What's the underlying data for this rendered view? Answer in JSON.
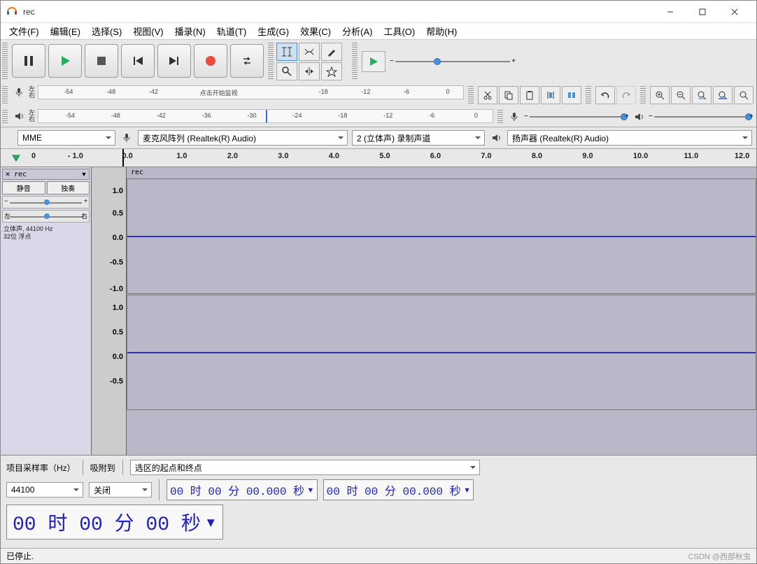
{
  "window": {
    "title": "rec"
  },
  "menu": [
    "文件(F)",
    "编辑(E)",
    "选择(S)",
    "视图(V)",
    "播录(N)",
    "轨道(T)",
    "生成(G)",
    "效果(C)",
    "分析(A)",
    "工具(O)",
    "帮助(H)"
  ],
  "rec_meter": {
    "ticks": [
      "-54",
      "-48",
      "-42",
      "",
      "",
      "-18",
      "-12",
      "-6",
      "0"
    ],
    "hint": "点击开始监视"
  },
  "play_meter": {
    "ticks": [
      "-54",
      "-48",
      "-42",
      "-36",
      "-30",
      "-24",
      "-18",
      "-12",
      "-6",
      "0"
    ]
  },
  "device": {
    "host_label": "MME",
    "rec_device": "麦克风阵列 (Realtek(R) Audio)",
    "channels": "2 (立体声) 录制声道",
    "play_device": "扬声器 (Realtek(R) Audio)"
  },
  "timeline": {
    "ticks": [
      "0",
      "- 1.0",
      "0.0",
      "1.0",
      "2.0",
      "3.0",
      "4.0",
      "5.0",
      "6.0",
      "7.0",
      "8.0",
      "9.0",
      "10.0",
      "11.0",
      "12.0"
    ]
  },
  "track": {
    "name": "rec",
    "mute": "静音",
    "solo": "独奏",
    "pan_l": "左",
    "pan_r": "右",
    "info1": "立体声, 44100 Hz",
    "info2": "32位 浮点"
  },
  "amp_labels_top": [
    "1.0",
    "0.5",
    "0.0",
    "-0.5",
    "-1.0"
  ],
  "amp_labels_bot": [
    "1.0",
    "0.5",
    "0.0",
    "-0.5"
  ],
  "bottom": {
    "rate_label": "项目采样率（Hz）",
    "snap_label": "吸附到",
    "selection_label": "选区的起点和终点",
    "rate_value": "44100",
    "snap_value": "关闭",
    "time1": "00 时 00 分 00.000 秒",
    "time2": "00 时 00 分 00.000 秒",
    "time_big": "00 时 00 分 00 秒"
  },
  "status": "已停止.",
  "watermark": "CSDN @西部秋虫"
}
